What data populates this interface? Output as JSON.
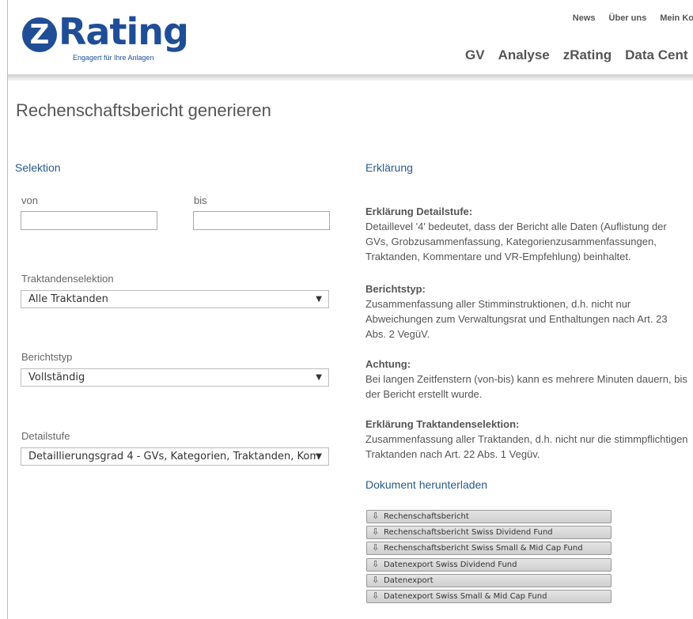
{
  "logo": {
    "mark": "Z",
    "word": "Rating",
    "tagline": "Engagert für Ihre Anlagen"
  },
  "topnav": [
    "News",
    "Über uns",
    "Mein Ko"
  ],
  "mainnav": [
    "GV",
    "Analyse",
    "zRating",
    "Data Cent"
  ],
  "page_title": "Rechenschaftsbericht generieren",
  "selektion": {
    "heading": "Selektion",
    "von_label": "von",
    "von_value": "",
    "bis_label": "bis",
    "bis_value": "",
    "traktanden_label": "Traktandenselektion",
    "traktanden_value": "Alle Traktanden",
    "berichtstyp_label": "Berichtstyp",
    "berichtstyp_value": "Vollständig",
    "detailstufe_label": "Detailstufe",
    "detailstufe_value": "Detaillierungsgrad 4 - GVs, Kategorien, Traktanden, Kom"
  },
  "erklaerung": {
    "heading": "Erklärung",
    "items": [
      {
        "title": "Erklärung Detailstufe:",
        "text": "Detaillevel '4' bedeutet, dass der Bericht alle Daten (Auflistung der GVs, Grobzusammenfassung, Kategorienzusammenfassungen, Traktanden, Kommentare und VR-Empfehlung) beinhaltet."
      },
      {
        "title": "Berichtstyp:",
        "text": "Zusammenfassung aller Stimminstruktionen, d.h. nicht nur Abweichungen zum Verwaltungsrat und Enthaltungen nach Art. 23 Abs. 2 VegüV."
      },
      {
        "title": "Achtung:",
        "text": "Bei langen Zeitfenstern (von-bis) kann es mehrere Minuten dauern, bis der Bericht erstellt wurde."
      },
      {
        "title": "Erklärung Traktandenselektion:",
        "text": "Zusammenfassung aller Traktanden, d.h. nicht nur die stimmpflichtigen Traktanden nach Art. 22 Abs. 1 Vegüv."
      }
    ]
  },
  "download": {
    "heading": "Dokument herunterladen",
    "buttons": [
      "Rechenschaftsbericht",
      "Rechenschaftsbericht Swiss Dividend Fund",
      "Rechenschaftsbericht Swiss Small & Mid Cap Fund",
      "Datenexport Swiss Dividend Fund",
      "Datenexport",
      "Datenexport Swiss Small & Mid Cap Fund"
    ]
  },
  "icons": {
    "dropdown": "chevron-down-icon",
    "download": "export-icon"
  }
}
